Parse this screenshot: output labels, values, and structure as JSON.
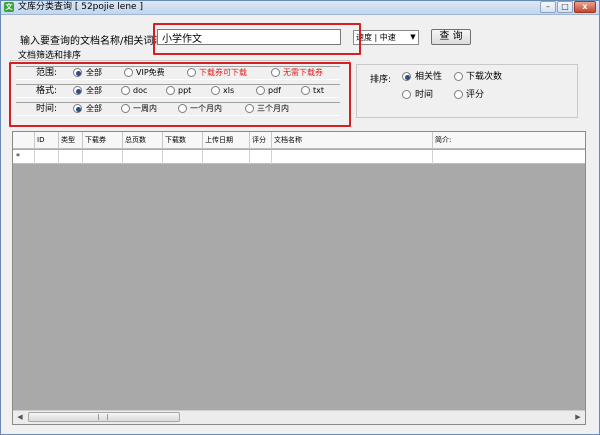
{
  "window": {
    "title": "文库分类查询 [ 52pojie lene ]",
    "icon": "文",
    "min_glyph": "–",
    "max_glyph": "□",
    "close_glyph": "x"
  },
  "search": {
    "label": "输入要查询的文档名称/相关词汇:",
    "value": "小学作文",
    "speed": "速度 | 中速",
    "speed_arrow": "▼",
    "button": "查 询"
  },
  "filters": {
    "legend": "文档筛选和排序",
    "scope": {
      "label": "范围:",
      "options": [
        "全部",
        "VIP免费",
        "下载券可下载",
        "无需下载券"
      ]
    },
    "format": {
      "label": "格式:",
      "options": [
        "全部",
        "doc",
        "ppt",
        "xls",
        "pdf",
        "txt"
      ]
    },
    "time": {
      "label": "时间:",
      "options": [
        "全部",
        "一周内",
        "一个月内",
        "三个月内"
      ]
    }
  },
  "sort": {
    "label": "排序:",
    "options": [
      "相关性",
      "下载次数",
      "时间",
      "评分"
    ]
  },
  "grid": {
    "columns": [
      "ID",
      "类型",
      "下载券",
      "总页数",
      "下载数",
      "上传日期",
      "评分",
      "文档名称",
      "简介:"
    ],
    "new_row_indicator": "*"
  },
  "scrollbar": {
    "left_glyph": "◀",
    "right_glyph": "▶"
  },
  "colors": {
    "highlight": "#d42020",
    "red_option": "#e02020",
    "grid_empty": "#a9a9a9"
  }
}
